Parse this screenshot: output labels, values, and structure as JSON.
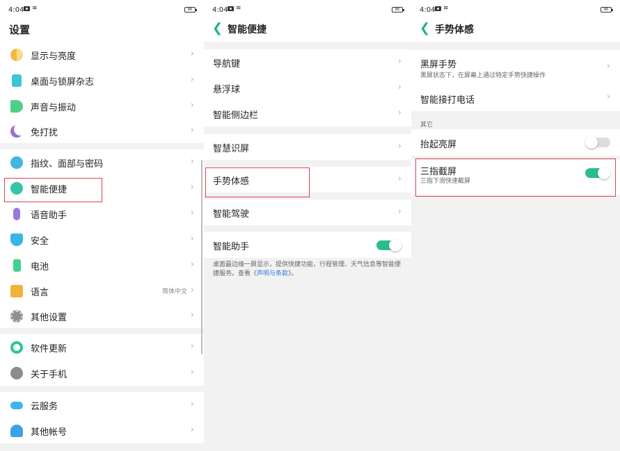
{
  "status": {
    "time": "4:04",
    "wifi": "≋",
    "battery": "86"
  },
  "colors": {
    "accent": "#2bbd8a",
    "link": "#2f7fd4",
    "highlight": "#d9434f"
  },
  "settings": {
    "title": "设置",
    "items": [
      {
        "label": "显示与亮度",
        "icon": "display-brightness-icon"
      },
      {
        "label": "桌面与锁屏杂志",
        "icon": "desktop-lockscreen-icon"
      },
      {
        "label": "声音与振动",
        "icon": "sound-vibration-icon"
      },
      {
        "label": "免打扰",
        "icon": "moon-icon"
      },
      {
        "label": "指纹、面部与密码",
        "icon": "fingerprint-icon"
      },
      {
        "label": "智能便捷",
        "icon": "smart-convenience-icon"
      },
      {
        "label": "语音助手",
        "icon": "microphone-icon"
      },
      {
        "label": "安全",
        "icon": "shield-icon"
      },
      {
        "label": "电池",
        "icon": "battery-icon"
      },
      {
        "label": "语言",
        "icon": "language-icon",
        "value": "简体中文"
      },
      {
        "label": "其他设置",
        "icon": "gear-icon"
      },
      {
        "label": "软件更新",
        "icon": "update-icon"
      },
      {
        "label": "关于手机",
        "icon": "info-icon"
      },
      {
        "label": "云服务",
        "icon": "cloud-icon"
      },
      {
        "label": "其他帐号",
        "icon": "account-icon"
      }
    ]
  },
  "smart": {
    "back": "❮",
    "title": "智能便捷",
    "items": [
      {
        "label": "导航键"
      },
      {
        "label": "悬浮球"
      },
      {
        "label": "智能侧边栏"
      },
      {
        "label": "智慧识屏"
      },
      {
        "label": "手势体感"
      },
      {
        "label": "智能驾驶"
      },
      {
        "label": "智能助手",
        "toggle": true
      }
    ],
    "note_text": "桌面最边缘一屏显示，提供快捷功能，行程管理、天气信息等智能便捷服务。查看",
    "note_link": "《声明与条款》",
    "note_end": "。"
  },
  "gesture": {
    "back": "❮",
    "title": "手势体感",
    "screen_off_title": "黑屏手势",
    "screen_off_sub": "黑屏状态下，在屏幕上通过特定手势快捷操作",
    "smart_call": "智能接打电话",
    "other_label": "其它",
    "raise_wake": "抬起亮屏",
    "raise_wake_on": false,
    "three_finger_title": "三指截屏",
    "three_finger_sub": "三指下滑快速截屏",
    "three_finger_on": true
  },
  "chevron": "›"
}
